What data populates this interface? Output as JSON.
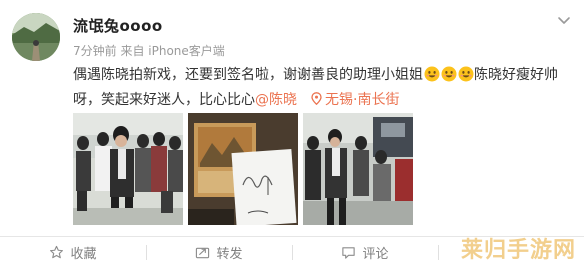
{
  "post": {
    "username": "流氓兔oooo",
    "meta": "7分钟前 来自 iPhone客户端",
    "text_line1": "偶遇陈晓拍新戏，还要到签名啦，谢谢善良的助理小姐姐",
    "text_after_emoji": "陈晓好瘦好帅",
    "text_line2": "呀，笑起来好迷人，比心比心",
    "mention": "@陈晓",
    "location": "无锡·南长街",
    "emoji_name": "smile-emoji",
    "emoji_count": 3
  },
  "photos": [
    {
      "name": "photo-street-crowd"
    },
    {
      "name": "photo-autograph"
    },
    {
      "name": "photo-film-set"
    }
  ],
  "actions": {
    "favorite_label": "收藏",
    "repost_label": "转发",
    "comment_label": "评论",
    "like_label": ""
  },
  "watermark": "莱归手游网",
  "colors": {
    "accent": "#eb7350",
    "text": "#333333",
    "meta": "#9a9a9a",
    "action": "#808080"
  }
}
